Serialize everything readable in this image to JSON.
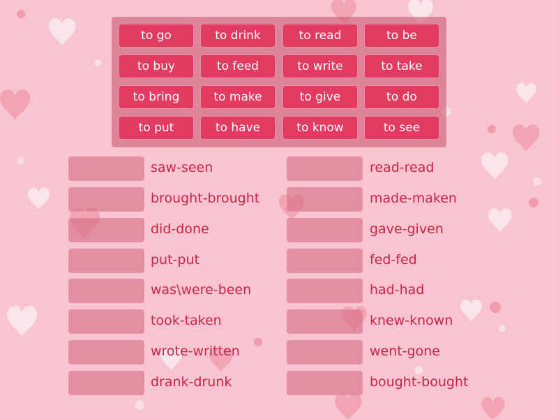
{
  "colors": {
    "background": "#f7c4d0",
    "tile": "#e23a60",
    "tile_text": "#ffffff",
    "label_text": "#c8234b",
    "bank_panel": "#c85069"
  },
  "word_bank": {
    "tiles": [
      "to go",
      "to drink",
      "to read",
      "to be",
      "to buy",
      "to feed",
      "to write",
      "to take",
      "to bring",
      "to make",
      "to give",
      "to do",
      "to put",
      "to have",
      "to know",
      "to see"
    ]
  },
  "targets": {
    "left": [
      "saw-seen",
      "brought-brought",
      "did-done",
      "put-put",
      "was\\were-been",
      "took-taken",
      "wrote-written",
      "drank-drunk"
    ],
    "right": [
      "read-read",
      "made-maken",
      "gave-given",
      "fed-fed",
      "had-had",
      "knew-known",
      "went-gone",
      "bought-bought"
    ]
  }
}
